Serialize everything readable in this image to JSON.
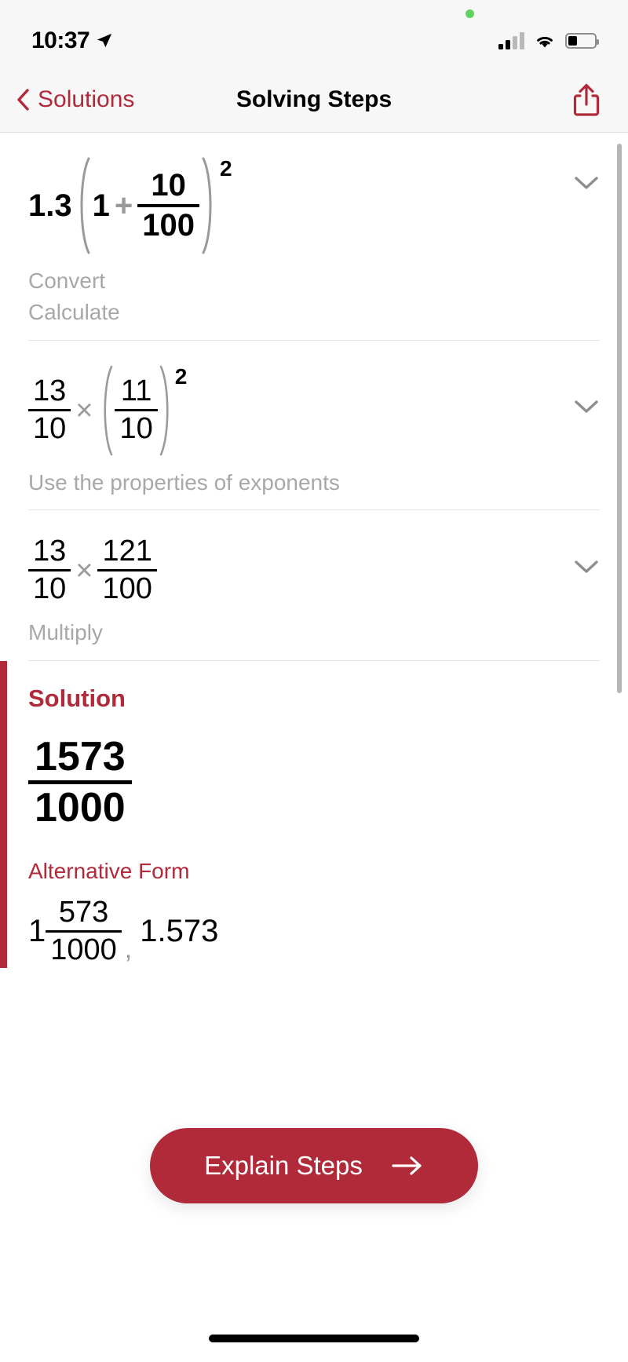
{
  "status_bar": {
    "time": "10:37",
    "location_icon": "location-arrow-icon",
    "privacy_indicator": "green-dot-icon",
    "signal_icon": "cellular-signal-icon",
    "wifi_icon": "wifi-icon",
    "battery_icon": "battery-icon",
    "battery_level_pct": 33,
    "signal_bars_filled": 2,
    "signal_bars_total": 4
  },
  "nav": {
    "back_label": "Solutions",
    "back_icon": "chevron-left-icon",
    "title": "Solving Steps",
    "share_icon": "share-icon"
  },
  "colors": {
    "accent": "#b02a3a",
    "muted_text": "#a8a8a8",
    "operator": "#9a9a9a",
    "divider": "#e2e2e2",
    "status_bg": "#f7f7f7",
    "privacy_dot": "#5fd35f"
  },
  "steps": [
    {
      "id": "step-1",
      "expression_text": "1.3(1 + 10/100)^2",
      "coefficient": "1.3",
      "operator": "+",
      "inner_left": "1",
      "fraction": {
        "numerator": "10",
        "denominator": "100"
      },
      "exponent": "2",
      "hints": [
        "Convert",
        "Calculate"
      ],
      "chevron_icon": "chevron-down-icon"
    },
    {
      "id": "step-2",
      "expression_text": "13/10 × (11/10)^2",
      "left_fraction": {
        "numerator": "13",
        "denominator": "10"
      },
      "operator": "×",
      "inner_fraction": {
        "numerator": "11",
        "denominator": "10"
      },
      "exponent": "2",
      "hints": [
        "Use the properties of exponents"
      ],
      "chevron_icon": "chevron-down-icon"
    },
    {
      "id": "step-3",
      "expression_text": "13/10 × 121/100",
      "left_fraction": {
        "numerator": "13",
        "denominator": "10"
      },
      "operator": "×",
      "right_fraction": {
        "numerator": "121",
        "denominator": "100"
      },
      "hints": [
        "Multiply"
      ],
      "chevron_icon": "chevron-down-icon"
    }
  ],
  "solution": {
    "title": "Solution",
    "fraction": {
      "numerator": "1573",
      "denominator": "1000"
    },
    "alternative_title": "Alternative Form",
    "alternative": {
      "mixed_integer": "1",
      "mixed_fraction": {
        "numerator": "573",
        "denominator": "1000"
      },
      "separator": ",",
      "decimal": "1.573"
    }
  },
  "explain_button": {
    "label": "Explain Steps",
    "arrow_icon": "arrow-right-icon"
  }
}
